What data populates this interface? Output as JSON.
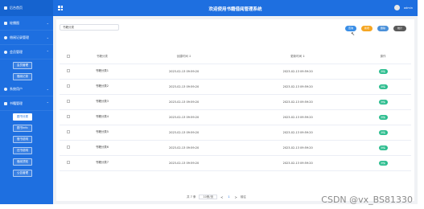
{
  "header": {
    "title": "欢迎使用书籍借阅管理系统",
    "user": "admin"
  },
  "sidebar": {
    "top": "后台首页",
    "items": [
      {
        "label": "轮播图",
        "icon": "image-icon"
      },
      {
        "label": "借阅记录管理",
        "icon": "gear-icon"
      },
      {
        "label": "会员管理",
        "icon": "user-icon",
        "subs": [
          "会员管理",
          "借阅记录"
        ]
      },
      {
        "label": "系统用户",
        "icon": "user-icon"
      },
      {
        "label": "书籍管理",
        "icon": "book-icon",
        "subs": [
          "图书分类",
          "图书info",
          "借书说明",
          "还书说明",
          "借阅须知",
          "公告管理"
        ]
      }
    ]
  },
  "toolbar": {
    "search_placeholder": "书籍分类",
    "search_label": "查询",
    "add_label": "新增",
    "delete_label": "删除",
    "stat_label": "统计"
  },
  "table": {
    "columns": [
      "书籍分类",
      "创建时间 ↕",
      "更新时间 ↕",
      "操作"
    ],
    "detail_label": "详情",
    "rows": [
      {
        "name": "书籍分类1",
        "created": "2023-02-13 09:59:20",
        "updated": "2023-02-13 09:59:20"
      },
      {
        "name": "书籍分类2",
        "created": "2023-02-13 09:59:20",
        "updated": "2023-02-13 09:59:20"
      },
      {
        "name": "书籍分类3",
        "created": "2023-02-13 09:59:20",
        "updated": "2023-02-13 09:59:20"
      },
      {
        "name": "书籍分类4",
        "created": "2023-02-13 09:59:20",
        "updated": "2023-02-13 09:59:20"
      },
      {
        "name": "书籍分类5",
        "created": "2023-02-13 09:59:20",
        "updated": "2023-02-13 09:59:20"
      },
      {
        "name": "书籍分类6",
        "created": "2023-02-13 09:59:20",
        "updated": "2023-02-13 09:59:20"
      },
      {
        "name": "书籍分类7",
        "created": "2023-02-13 09:59:20",
        "updated": "2023-02-13 09:59:20"
      }
    ]
  },
  "pagination": {
    "total": "共 7 条",
    "page_size": "10条/页",
    "prev": "<",
    "page": "1",
    "next": ">",
    "goto": "前往"
  },
  "watermark": "CSDN @vx_BS81330",
  "colors": {
    "primary": "#1e6fe0",
    "detail": "#2bbd8e",
    "add": "#f5a623"
  }
}
